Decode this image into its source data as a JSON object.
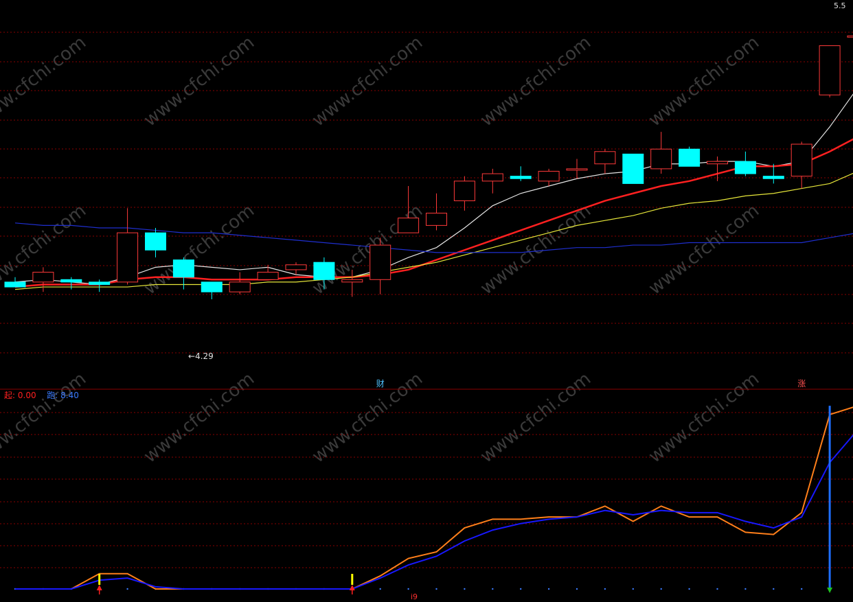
{
  "colors": {
    "background": "#000000",
    "grid": "#8b0000",
    "up_candle": "#ff3a3a",
    "down_candle": "#00ffff",
    "ma_white": "#e6e6e6",
    "ma_red": "#ff2020",
    "ma_yellow": "#e8e83a",
    "ma_blue": "#1f2fd0",
    "ind_orange": "#ff7f1a",
    "ind_blue": "#1818ff",
    "signal_yellow": "#ffff00",
    "signal_red": "#ff2020"
  },
  "watermark": "www.cfchi.com",
  "price_panel": {
    "last_price_label": "5.5",
    "low_marker_label": "4.29",
    "event_labels": [
      {
        "text": "财",
        "candle_index": 13
      },
      {
        "text": "涨",
        "candle_index": 28
      }
    ]
  },
  "indicator_panel": {
    "legend": [
      {
        "name": "起",
        "value": "0.00",
        "color": "#ff2020"
      },
      {
        "name": "跑",
        "value": "8.40",
        "color": "#3a7bff"
      }
    ],
    "bottom_label": "i9"
  },
  "chart_data": [
    {
      "type": "candlestick",
      "title": "",
      "ylim": [
        4.1,
        5.6
      ],
      "candles": [
        {
          "o": 4.46,
          "h": 4.48,
          "l": 4.44,
          "c": 4.44
        },
        {
          "o": 4.46,
          "h": 4.52,
          "l": 4.42,
          "c": 4.5
        },
        {
          "o": 4.47,
          "h": 4.48,
          "l": 4.43,
          "c": 4.46
        },
        {
          "o": 4.46,
          "h": 4.47,
          "l": 4.42,
          "c": 4.45
        },
        {
          "o": 4.46,
          "h": 4.76,
          "l": 4.45,
          "c": 4.66
        },
        {
          "o": 4.66,
          "h": 4.68,
          "l": 4.56,
          "c": 4.59
        },
        {
          "o": 4.55,
          "h": 4.56,
          "l": 4.43,
          "c": 4.48
        },
        {
          "o": 4.46,
          "h": 4.46,
          "l": 4.39,
          "c": 4.42
        },
        {
          "o": 4.42,
          "h": 4.5,
          "l": 4.41,
          "c": 4.46
        },
        {
          "o": 4.47,
          "h": 4.53,
          "l": 4.47,
          "c": 4.5
        },
        {
          "o": 4.51,
          "h": 4.54,
          "l": 4.49,
          "c": 4.53
        },
        {
          "o": 4.54,
          "h": 4.56,
          "l": 4.43,
          "c": 4.47
        },
        {
          "o": 4.46,
          "h": 4.51,
          "l": 4.4,
          "c": 4.47
        },
        {
          "o": 4.47,
          "h": 4.64,
          "l": 4.41,
          "c": 4.61
        },
        {
          "o": 4.66,
          "h": 4.85,
          "l": 4.66,
          "c": 4.72
        },
        {
          "o": 4.69,
          "h": 4.82,
          "l": 4.67,
          "c": 4.74
        },
        {
          "o": 4.79,
          "h": 4.89,
          "l": 4.75,
          "c": 4.87
        },
        {
          "o": 4.87,
          "h": 4.92,
          "l": 4.82,
          "c": 4.9
        },
        {
          "o": 4.89,
          "h": 4.93,
          "l": 4.87,
          "c": 4.88
        },
        {
          "o": 4.87,
          "h": 4.92,
          "l": 4.85,
          "c": 4.91
        },
        {
          "o": 4.92,
          "h": 4.96,
          "l": 4.88,
          "c": 4.92
        },
        {
          "o": 4.94,
          "h": 5.0,
          "l": 4.9,
          "c": 4.99
        },
        {
          "o": 4.98,
          "h": 4.98,
          "l": 4.86,
          "c": 4.86
        },
        {
          "o": 4.92,
          "h": 5.07,
          "l": 4.9,
          "c": 5.0
        },
        {
          "o": 5.0,
          "h": 5.01,
          "l": 4.93,
          "c": 4.93
        },
        {
          "o": 4.94,
          "h": 4.97,
          "l": 4.87,
          "c": 4.95
        },
        {
          "o": 4.95,
          "h": 4.99,
          "l": 4.89,
          "c": 4.9
        },
        {
          "o": 4.89,
          "h": 4.94,
          "l": 4.86,
          "c": 4.88
        },
        {
          "o": 4.89,
          "h": 5.03,
          "l": 4.84,
          "c": 5.02
        },
        {
          "o": 5.22,
          "h": 5.42,
          "l": 5.21,
          "c": 5.42
        },
        {
          "o": 5.46,
          "h": 5.55,
          "l": 5.33,
          "c": 5.46
        }
      ],
      "overlays": [
        {
          "name": "",
          "color_key": "ma_white",
          "values": [
            4.46,
            4.47,
            4.46,
            4.45,
            4.48,
            4.52,
            4.53,
            4.52,
            4.51,
            4.52,
            4.49,
            4.48,
            4.48,
            4.51,
            4.56,
            4.6,
            4.68,
            4.77,
            4.82,
            4.85,
            4.88,
            4.9,
            4.91,
            4.94,
            4.94,
            4.95,
            4.95,
            4.93,
            4.95,
            5.09,
            5.25
          ]
        },
        {
          "name": "",
          "color_key": "ma_red",
          "values": [
            4.44,
            4.45,
            4.45,
            4.45,
            4.47,
            4.48,
            4.48,
            4.47,
            4.47,
            4.47,
            4.48,
            4.48,
            4.48,
            4.49,
            4.51,
            4.55,
            4.59,
            4.63,
            4.67,
            4.71,
            4.75,
            4.79,
            4.82,
            4.85,
            4.87,
            4.9,
            4.93,
            4.93,
            4.94,
            4.99,
            5.05
          ]
        },
        {
          "name": "",
          "color_key": "ma_yellow",
          "values": [
            4.43,
            4.44,
            4.44,
            4.44,
            4.44,
            4.45,
            4.45,
            4.45,
            4.45,
            4.46,
            4.46,
            4.47,
            4.48,
            4.5,
            4.52,
            4.54,
            4.57,
            4.6,
            4.63,
            4.66,
            4.69,
            4.71,
            4.73,
            4.76,
            4.78,
            4.79,
            4.81,
            4.82,
            4.84,
            4.86,
            4.91
          ]
        },
        {
          "name": "",
          "color_key": "ma_blue",
          "values": [
            4.7,
            4.69,
            4.69,
            4.68,
            4.68,
            4.67,
            4.66,
            4.66,
            4.65,
            4.64,
            4.63,
            4.62,
            4.61,
            4.6,
            4.59,
            4.58,
            4.58,
            4.58,
            4.58,
            4.59,
            4.6,
            4.6,
            4.61,
            4.61,
            4.62,
            4.62,
            4.62,
            4.62,
            4.62,
            4.64,
            4.66
          ]
        }
      ]
    },
    {
      "type": "line",
      "title": "",
      "ylim": [
        0,
        8.5
      ],
      "series": [
        {
          "name": "",
          "color_key": "ind_orange",
          "values": [
            0,
            0,
            0,
            0.7,
            0.7,
            0,
            0,
            0,
            0,
            0,
            0,
            0,
            0,
            0.6,
            1.4,
            1.7,
            2.8,
            3.2,
            3.2,
            3.3,
            3.3,
            3.8,
            3.1,
            3.8,
            3.3,
            3.3,
            2.6,
            2.5,
            3.5,
            8.0,
            8.4
          ]
        },
        {
          "name": "",
          "color_key": "ind_blue",
          "values": [
            0,
            0,
            0,
            0.4,
            0.5,
            0.1,
            0,
            0,
            0,
            0,
            0,
            0,
            0,
            0.5,
            1.1,
            1.5,
            2.2,
            2.7,
            3.0,
            3.2,
            3.3,
            3.6,
            3.4,
            3.6,
            3.5,
            3.5,
            3.1,
            2.8,
            3.3,
            5.8,
            7.3
          ]
        }
      ],
      "signals": [
        {
          "index": 3,
          "type": "arrow-up"
        },
        {
          "index": 12,
          "type": "arrow-up"
        },
        {
          "index": 29,
          "type": "arrow-down"
        }
      ]
    }
  ]
}
